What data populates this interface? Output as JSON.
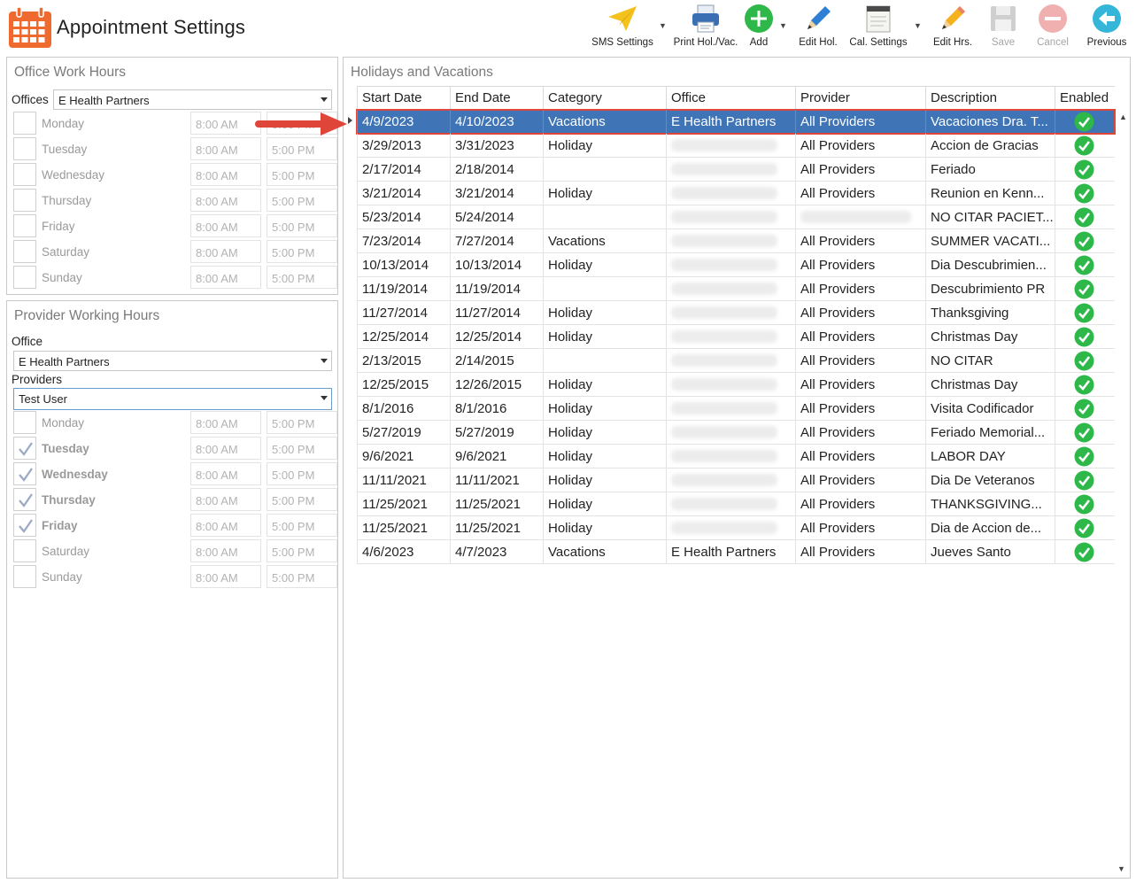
{
  "header": {
    "title": "Appointment Settings"
  },
  "toolbar": {
    "sms_settings": "SMS Settings",
    "print_hol": "Print Hol./Vac.",
    "add": "Add",
    "edit_hol": "Edit Hol.",
    "cal_settings": "Cal. Settings",
    "edit_hrs": "Edit Hrs.",
    "save": "Save",
    "cancel": "Cancel",
    "previous": "Previous"
  },
  "office_hours": {
    "title": "Office Work Hours",
    "offices_label": "Offices",
    "office_value": "E Health Partners",
    "days": [
      {
        "name": "Monday",
        "start": "8:00 AM",
        "end": "5:00 PM",
        "checked": false
      },
      {
        "name": "Tuesday",
        "start": "8:00 AM",
        "end": "5:00 PM",
        "checked": false
      },
      {
        "name": "Wednesday",
        "start": "8:00 AM",
        "end": "5:00 PM",
        "checked": false
      },
      {
        "name": "Thursday",
        "start": "8:00 AM",
        "end": "5:00 PM",
        "checked": false
      },
      {
        "name": "Friday",
        "start": "8:00 AM",
        "end": "5:00 PM",
        "checked": false
      },
      {
        "name": "Saturday",
        "start": "8:00 AM",
        "end": "5:00 PM",
        "checked": false
      },
      {
        "name": "Sunday",
        "start": "8:00 AM",
        "end": "5:00 PM",
        "checked": false
      }
    ]
  },
  "provider_hours": {
    "title": "Provider Working Hours",
    "office_label": "Office",
    "office_value": "E Health Partners",
    "providers_label": "Providers",
    "provider_value": "Test User",
    "days": [
      {
        "name": "Monday",
        "start": "8:00 AM",
        "end": "5:00 PM",
        "checked": false
      },
      {
        "name": "Tuesday",
        "start": "8:00 AM",
        "end": "5:00 PM",
        "checked": true
      },
      {
        "name": "Wednesday",
        "start": "8:00 AM",
        "end": "5:00 PM",
        "checked": true
      },
      {
        "name": "Thursday",
        "start": "8:00 AM",
        "end": "5:00 PM",
        "checked": true
      },
      {
        "name": "Friday",
        "start": "8:00 AM",
        "end": "5:00 PM",
        "checked": true
      },
      {
        "name": "Saturday",
        "start": "8:00 AM",
        "end": "5:00 PM",
        "checked": false
      },
      {
        "name": "Sunday",
        "start": "8:00 AM",
        "end": "5:00 PM",
        "checked": false
      }
    ]
  },
  "holidays": {
    "title": "Holidays and Vacations",
    "columns": [
      "Start Date",
      "End Date",
      "Category",
      "Office",
      "Provider",
      "Description",
      "Enabled"
    ],
    "rows": [
      {
        "start": "4/9/2023",
        "end": "4/10/2023",
        "category": "Vacations",
        "office": "E Health Partners",
        "provider": "All Providers",
        "description": "Vacaciones Dra. T...",
        "enabled": true
      },
      {
        "start": "3/29/2013",
        "end": "3/31/2023",
        "category": "Holiday",
        "office": "",
        "provider": "All Providers",
        "description": "Accion de Gracias",
        "enabled": true
      },
      {
        "start": "2/17/2014",
        "end": "2/18/2014",
        "category": "",
        "office": "",
        "provider": "All Providers",
        "description": "Feriado",
        "enabled": true
      },
      {
        "start": "3/21/2014",
        "end": "3/21/2014",
        "category": "Holiday",
        "office": "",
        "provider": "All Providers",
        "description": "Reunion en Kenn...",
        "enabled": true
      },
      {
        "start": "5/23/2014",
        "end": "5/24/2014",
        "category": "",
        "office": "",
        "provider": "",
        "description": "NO CITAR PACIET...",
        "enabled": true
      },
      {
        "start": "7/23/2014",
        "end": "7/27/2014",
        "category": "Vacations",
        "office": "",
        "provider": "All Providers",
        "description": "SUMMER VACATI...",
        "enabled": true
      },
      {
        "start": "10/13/2014",
        "end": "10/13/2014",
        "category": "Holiday",
        "office": "",
        "provider": "All Providers",
        "description": "Dia Descubrimien...",
        "enabled": true
      },
      {
        "start": "11/19/2014",
        "end": "11/19/2014",
        "category": "",
        "office": "",
        "provider": "All Providers",
        "description": "Descubrimiento PR",
        "enabled": true
      },
      {
        "start": "11/27/2014",
        "end": "11/27/2014",
        "category": "Holiday",
        "office": "",
        "provider": "All Providers",
        "description": "Thanksgiving",
        "enabled": true
      },
      {
        "start": "12/25/2014",
        "end": "12/25/2014",
        "category": "Holiday",
        "office": "",
        "provider": "All Providers",
        "description": "Christmas Day",
        "enabled": true
      },
      {
        "start": "2/13/2015",
        "end": "2/14/2015",
        "category": "",
        "office": "",
        "provider": "All Providers",
        "description": "NO CITAR",
        "enabled": true
      },
      {
        "start": "12/25/2015",
        "end": "12/26/2015",
        "category": "Holiday",
        "office": "",
        "provider": "All Providers",
        "description": "Christmas Day",
        "enabled": true
      },
      {
        "start": "8/1/2016",
        "end": "8/1/2016",
        "category": "Holiday",
        "office": "",
        "provider": "All Providers",
        "description": "Visita Codificador",
        "enabled": true
      },
      {
        "start": "5/27/2019",
        "end": "5/27/2019",
        "category": "Holiday",
        "office": "",
        "provider": "All Providers",
        "description": "Feriado Memorial...",
        "enabled": true
      },
      {
        "start": "9/6/2021",
        "end": "9/6/2021",
        "category": "Holiday",
        "office": "",
        "provider": "All Providers",
        "description": "LABOR DAY",
        "enabled": true
      },
      {
        "start": "11/11/2021",
        "end": "11/11/2021",
        "category": "Holiday",
        "office": "",
        "provider": "All Providers",
        "description": "Dia De Veteranos",
        "enabled": true
      },
      {
        "start": "11/25/2021",
        "end": "11/25/2021",
        "category": "Holiday",
        "office": "",
        "provider": "All Providers",
        "description": "THANKSGIVING...",
        "enabled": true
      },
      {
        "start": "11/25/2021",
        "end": "11/25/2021",
        "category": "Holiday",
        "office": "",
        "provider": "All Providers",
        "description": "Dia de Accion de...",
        "enabled": true
      },
      {
        "start": "4/6/2023",
        "end": "4/7/2023",
        "category": "Vacations",
        "office": "E Health Partners",
        "provider": "All Providers",
        "description": "Jueves Santo",
        "enabled": true
      }
    ]
  },
  "colors": {
    "accent": "#3f74b6",
    "highlight": "#e0453a",
    "enabled": "#2fb84a"
  }
}
